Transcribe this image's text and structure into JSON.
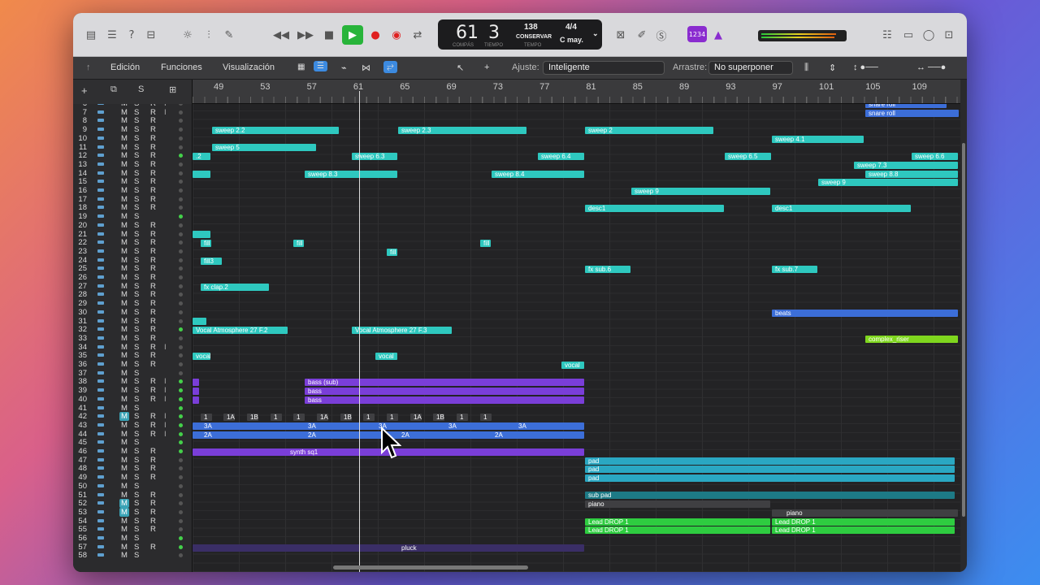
{
  "toolbar": {
    "lcd": {
      "bar": "61",
      "beat": "3",
      "bar_label": "COMPÁS",
      "beat_label": "TIEMPO",
      "tempo": "138",
      "tempo_mode": "CONSERVAR",
      "tempo_label": "TEMPO",
      "signature": "4/4",
      "key": "C may."
    },
    "badge": "1234"
  },
  "subbar": {
    "menus": [
      "Edición",
      "Funciones",
      "Visualización"
    ],
    "snap_label": "Ajuste:",
    "snap_value": "Inteligente",
    "drag_label": "Arrastre:",
    "drag_value": "No superponer"
  },
  "ruler": [
    "49",
    "53",
    "57",
    "61",
    "65",
    "69",
    "73",
    "77",
    "81",
    "85",
    "89",
    "93",
    "97",
    "101",
    "105",
    "109"
  ],
  "tracks": [
    {
      "n": "6"
    },
    {
      "n": "7"
    },
    {
      "n": "8"
    },
    {
      "n": "9"
    },
    {
      "n": "10"
    },
    {
      "n": "11"
    },
    {
      "n": "12"
    },
    {
      "n": "13"
    },
    {
      "n": "14"
    },
    {
      "n": "15"
    },
    {
      "n": "16"
    },
    {
      "n": "17"
    },
    {
      "n": "18"
    },
    {
      "n": "19"
    },
    {
      "n": "20"
    },
    {
      "n": "21"
    },
    {
      "n": "22"
    },
    {
      "n": "23"
    },
    {
      "n": "24"
    },
    {
      "n": "25"
    },
    {
      "n": "26"
    },
    {
      "n": "27"
    },
    {
      "n": "28"
    },
    {
      "n": "29"
    },
    {
      "n": "30"
    },
    {
      "n": "31"
    },
    {
      "n": "32"
    },
    {
      "n": "33"
    },
    {
      "n": "34"
    },
    {
      "n": "35"
    },
    {
      "n": "36"
    },
    {
      "n": "37"
    },
    {
      "n": "38"
    },
    {
      "n": "39"
    },
    {
      "n": "40"
    },
    {
      "n": "41"
    },
    {
      "n": "42"
    },
    {
      "n": "43"
    },
    {
      "n": "44"
    },
    {
      "n": "45"
    },
    {
      "n": "46"
    },
    {
      "n": "47"
    },
    {
      "n": "48"
    },
    {
      "n": "49"
    },
    {
      "n": "50"
    },
    {
      "n": "51"
    },
    {
      "n": "52"
    },
    {
      "n": "53"
    },
    {
      "n": "54"
    },
    {
      "n": "55"
    },
    {
      "n": "56"
    },
    {
      "n": "57"
    },
    {
      "n": "58"
    }
  ],
  "track_buttons": {
    "m": "M",
    "s": "S",
    "r": "R",
    "i": "I"
  },
  "regions": {
    "snare_roll": "snare roll",
    "sweep_2_2": "sweep 2.2",
    "sweep_2_3": "sweep 2.3",
    "sweep_2": "sweep 2",
    "sweep_4_1": "sweep 4.1",
    "sweep_5": "sweep 5",
    "r_2": ".2",
    "sweep_6_3": "sweep 6.3",
    "sweep_6_4": "sweep 6.4",
    "sweep_6_5": "sweep 6.5",
    "sweep_6_6": "sweep 6.6",
    "sweep_7_3": "sweep 7.3",
    "sweep_8_3": "sweep 8.3",
    "sweep_8_4": "sweep 8.4",
    "sweep_8_8": "sweep 8.8",
    "sweep_9": "sweep 9",
    "desc1": "desc1",
    "fill": "fill",
    "fill3": "fill3",
    "fx_sub_6": "fx sub.6",
    "fx_sub_7": "fx sub.7",
    "fx_clap_2": "fx clap.2",
    "beats": "beats",
    "vocal_atm_f2": "Vocal Atmosphere 27 F.2",
    "vocal_atm_f3": "Vocal Atmosphere 27 F.3",
    "complex_riser": "complex_riser",
    "vocal": "vocal",
    "bass_sub": "bass (sub)",
    "bass": "bass",
    "b1": "1",
    "b1A": "1A",
    "b1B": "1B",
    "b3A": "3A",
    "b2A": "2A",
    "synth_sq1": "synth sq1",
    "pad": "pad",
    "sub_pad": "sub pad",
    "piano": "piano",
    "lead_drop": "Lead DROP 1",
    "pluck": "pluck"
  }
}
